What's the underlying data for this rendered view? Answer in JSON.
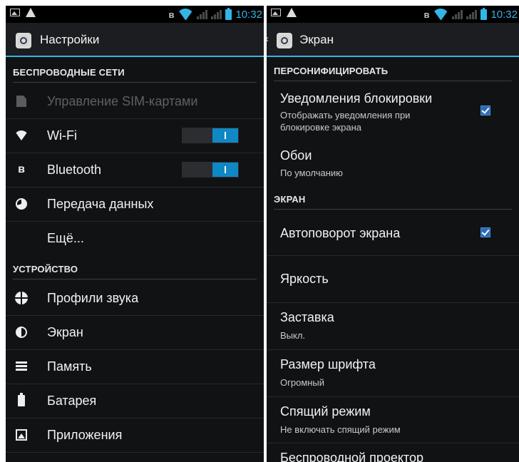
{
  "left_screen": {
    "status": {
      "time": "10:32"
    },
    "actionbar": {
      "title": "Настройки",
      "icon": "settings-gear-icon"
    },
    "sections": {
      "wireless": "БЕСПРОВОДНЫЕ СЕТИ",
      "device": "УСТРОЙСТВО"
    },
    "items": {
      "sim": {
        "label": "Управление SIM-картами",
        "icon": "sim-card-icon",
        "enabled": false
      },
      "wifi": {
        "label": "Wi-Fi",
        "icon": "wifi-icon",
        "toggle": "on"
      },
      "bluetooth": {
        "label": "Bluetooth",
        "icon": "bluetooth-icon",
        "toggle": "on"
      },
      "data": {
        "label": "Передача данных",
        "icon": "data-usage-icon"
      },
      "more": {
        "label": "Ещё..."
      },
      "sound": {
        "label": "Профили звука",
        "icon": "sound-profile-icon"
      },
      "screen": {
        "label": "Экран",
        "icon": "brightness-icon"
      },
      "memory": {
        "label": "Память",
        "icon": "storage-icon"
      },
      "battery": {
        "label": "Батарея",
        "icon": "battery-icon"
      },
      "apps": {
        "label": "Приложения",
        "icon": "apps-icon"
      }
    }
  },
  "right_screen": {
    "status": {
      "time": "10:32"
    },
    "actionbar": {
      "title": "Экран",
      "icon": "settings-gear-icon"
    },
    "sections": {
      "personalize": "ПЕРСОНИФИЦИРОВАТЬ",
      "screen": "ЭКРАН"
    },
    "items": {
      "lock_notif": {
        "title": "Уведомления блокировки",
        "summary_line1": "Отображать уведомления при",
        "summary_line2": "блокировке экрана",
        "checked": true
      },
      "wallpaper": {
        "title": "Обои",
        "summary": "По умолчанию"
      },
      "autorotate": {
        "title": "Автоповорот экрана",
        "checked": true
      },
      "brightness": {
        "title": "Яркость"
      },
      "daydream": {
        "title": "Заставка",
        "summary": "Выкл."
      },
      "font_size": {
        "title": "Размер шрифта",
        "summary": "Огромный"
      },
      "sleep": {
        "title": "Спящий режим",
        "summary": "Не включать спящий режим"
      },
      "wireless_display": {
        "title": "Беспроводной проектор"
      }
    }
  },
  "colors": {
    "accent": "#33b5e5",
    "background": "#111214",
    "toggle_on": "#0f88c4",
    "checkbox": "#2b6cb3"
  }
}
